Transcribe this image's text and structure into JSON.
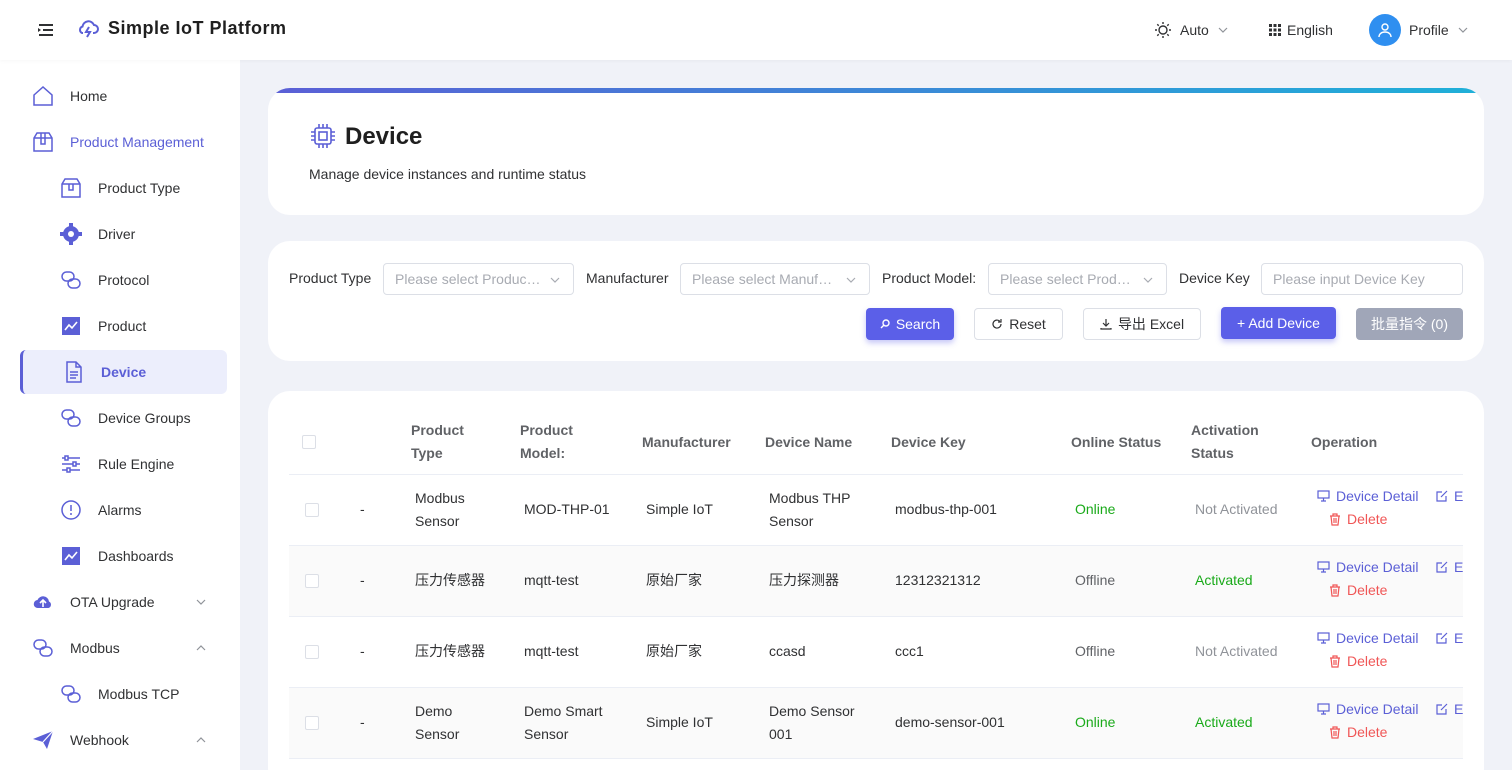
{
  "header": {
    "app_title": "Simple IoT Platform",
    "theme_label": "Auto",
    "language_label": "English",
    "profile_label": "Profile"
  },
  "sidebar": {
    "items": [
      {
        "label": "Home",
        "icon": "home-icon"
      },
      {
        "label": "Product Management",
        "icon": "box-icon",
        "expanded": true
      },
      {
        "label": "Product Type",
        "icon": "box-icon"
      },
      {
        "label": "Driver",
        "icon": "gear-icon"
      },
      {
        "label": "Protocol",
        "icon": "link-icon"
      },
      {
        "label": "Product",
        "icon": "chart-icon"
      },
      {
        "label": "Device",
        "icon": "document-icon",
        "active": true
      },
      {
        "label": "Device Groups",
        "icon": "link-icon"
      },
      {
        "label": "Rule Engine",
        "icon": "sliders-icon"
      },
      {
        "label": "Alarms",
        "icon": "alert-icon"
      },
      {
        "label": "Dashboards",
        "icon": "chart-icon"
      },
      {
        "label": "OTA Upgrade",
        "icon": "cloud-upload-icon"
      },
      {
        "label": "Modbus",
        "icon": "link-icon"
      },
      {
        "label": "Modbus TCP",
        "icon": "link-icon"
      },
      {
        "label": "Webhook",
        "icon": "send-icon"
      }
    ]
  },
  "page": {
    "title": "Device",
    "subtitle": "Manage device instances and runtime status"
  },
  "filters": {
    "product_type_label": "Product Type",
    "product_type_placeholder": "Please select Product Type",
    "manufacturer_label": "Manufacturer",
    "manufacturer_placeholder": "Please select Manufacturer",
    "product_model_label": "Product Model:",
    "product_model_placeholder": "Please select Product Model",
    "device_key_label": "Device Key",
    "device_key_placeholder": "Please input Device Key",
    "search_label": "Search",
    "reset_label": "Reset",
    "export_label": "导出 Excel",
    "add_label": "+ Add Device",
    "batch_label": "批量指令 (0)"
  },
  "table": {
    "columns": [
      "Product Type",
      "Product Model:",
      "Manufacturer",
      "Device Name",
      "Device Key",
      "Online Status",
      "Activation Status",
      "Operation"
    ],
    "op_detail": "Device Detail",
    "op_edit": "E",
    "op_delete": "Delete",
    "rows": [
      {
        "idx": "-",
        "product_type": "Modbus Sensor",
        "product_model": "MOD-THP-01",
        "manufacturer": "Simple IoT",
        "device_name": "Modbus THP Sensor",
        "device_key": "modbus-thp-001",
        "online": "Online",
        "activation": "Not Activated"
      },
      {
        "idx": "-",
        "product_type": "压力传感器",
        "product_model": "mqtt-test",
        "manufacturer": "原始厂家",
        "device_name": "压力探测器",
        "device_key": "12312321312",
        "online": "Offline",
        "activation": "Activated"
      },
      {
        "idx": "-",
        "product_type": "压力传感器",
        "product_model": "mqtt-test",
        "manufacturer": "原始厂家",
        "device_name": "ccasd",
        "device_key": "ccc1",
        "online": "Offline",
        "activation": "Not Activated"
      },
      {
        "idx": "-",
        "product_type": "Demo Sensor",
        "product_model": "Demo Smart Sensor",
        "manufacturer": "Simple IoT",
        "device_name": "Demo Sensor 001",
        "device_key": "demo-sensor-001",
        "online": "Online",
        "activation": "Activated"
      }
    ]
  },
  "colors": {
    "accent": "#5b5fd6",
    "online": "#1aaa1a",
    "danger": "#f05656"
  }
}
